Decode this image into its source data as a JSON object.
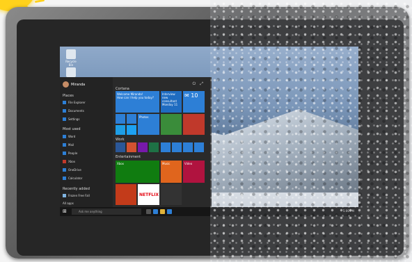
{
  "desktop": {
    "icons": [
      {
        "label": "Recycle Bin"
      },
      {
        "label": ""
      }
    ]
  },
  "start_menu": {
    "user_name": "Miranda",
    "places_heading": "Places",
    "places": [
      "File Explorer",
      "Documents",
      "Settings"
    ],
    "most_used_heading": "Most used",
    "most_used": [
      "Word",
      "Mail",
      "People",
      "Xbox",
      "OneDrive",
      "Calculator"
    ],
    "recently_added_heading": "Recently added",
    "recently_added": [
      "Frozen Free Fall"
    ],
    "all_apps_label": "All apps",
    "group_life": "Cortana",
    "group_work": "Work",
    "group_entertainment": "Entertainment",
    "tiles": {
      "cortana_greeting": "Welcome Miranda!",
      "cortana_sub": "How can I help you today?",
      "calendar_text": "Interview new consultant",
      "calendar_day": "Monday 11",
      "mail_count": "10",
      "mail_label": "Mail",
      "photos_label": "Photos",
      "xbox_label": "Xbox",
      "music_label": "Music",
      "video_label": "Video",
      "netflix_label": "NETFLIX"
    }
  },
  "taskbar": {
    "search_placeholder": "Ask me anything",
    "time": "5:00 PM"
  }
}
